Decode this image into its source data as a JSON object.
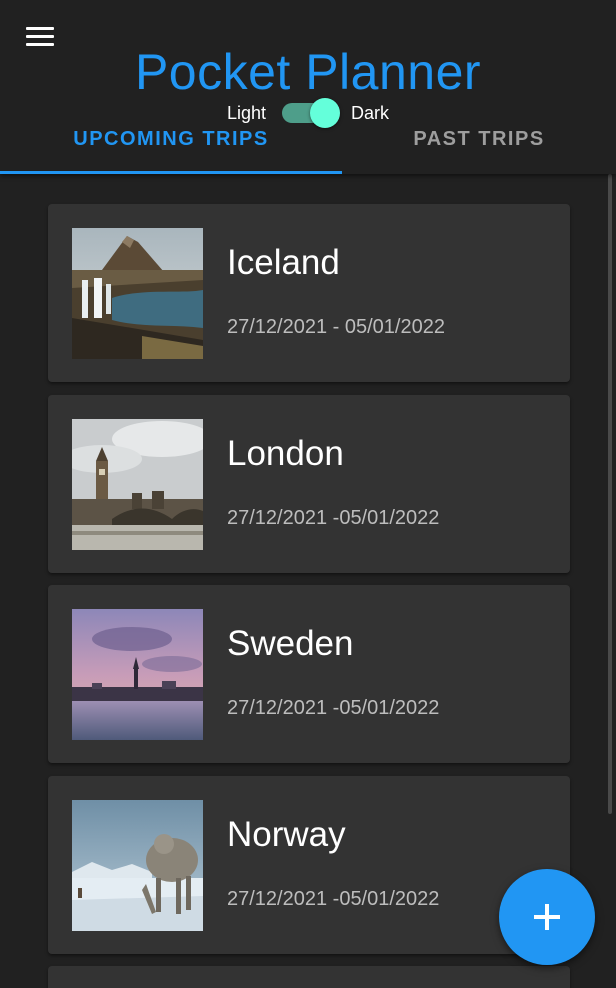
{
  "app": {
    "title": "Pocket Planner"
  },
  "theme_toggle": {
    "light_label": "Light",
    "dark_label": "Dark",
    "selected": "Dark"
  },
  "tabs": [
    {
      "label": "UPCOMING TRIPS",
      "active": true
    },
    {
      "label": "PAST TRIPS",
      "active": false
    }
  ],
  "trips": [
    {
      "name": "Iceland",
      "dates": "27/12/2021 - 05/01/2022"
    },
    {
      "name": "London",
      "dates": "27/12/2021 -05/01/2022"
    },
    {
      "name": "Sweden",
      "dates": "27/12/2021 -05/01/2022"
    },
    {
      "name": "Norway",
      "dates": "27/12/2021 -05/01/2022"
    }
  ],
  "colors": {
    "accent": "#2196f3",
    "switch_thumb": "#64ffda",
    "background": "#212121",
    "card": "#333333"
  },
  "icons": {
    "menu": "hamburger-menu-icon",
    "fab": "plus-icon"
  }
}
